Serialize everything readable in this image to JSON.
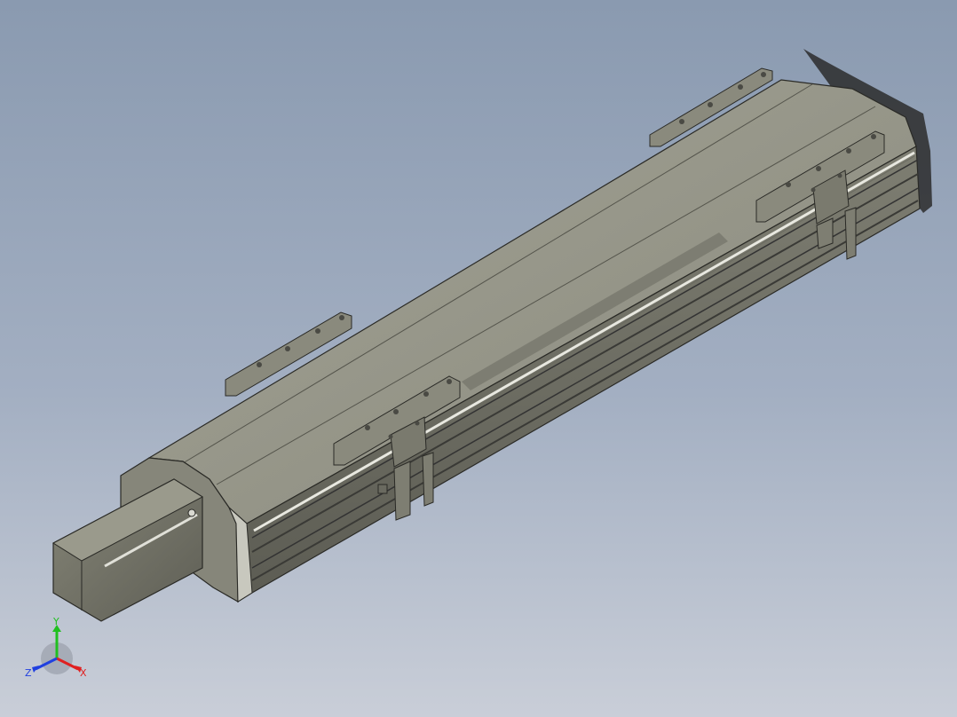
{
  "viewport": {
    "background_top": "#8a9ab0",
    "background_bottom": "#c9ced8",
    "model": "linear-actuator-assembly",
    "body_color": "#8c8c7e",
    "edge_color": "#2a2a26"
  },
  "triad": {
    "x_label": "X",
    "y_label": "Y",
    "z_label": "Z",
    "x_color": "#e02020",
    "y_color": "#20c020",
    "z_color": "#2040e0"
  }
}
